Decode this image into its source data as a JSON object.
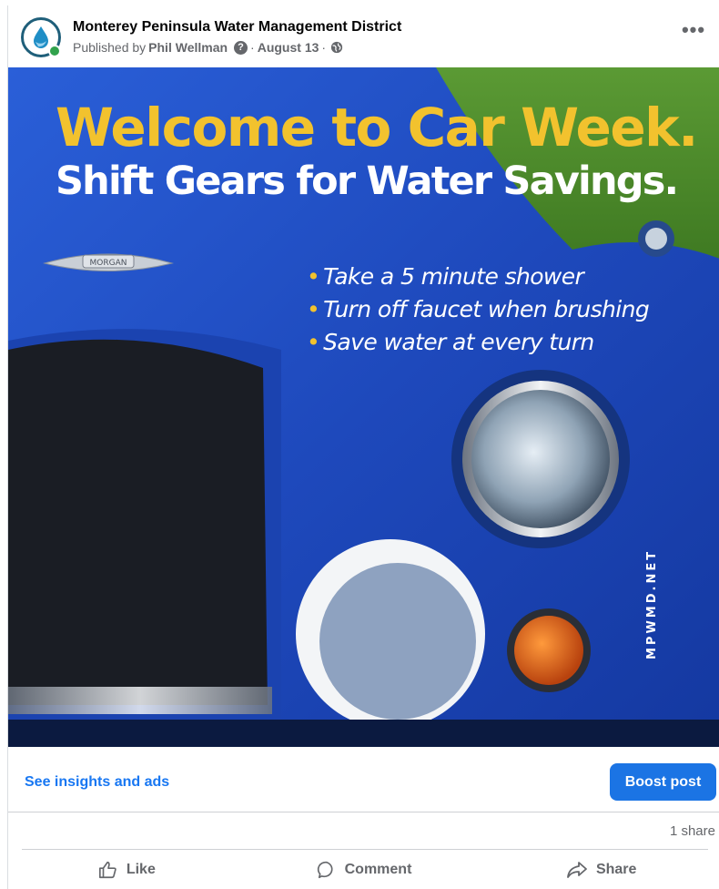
{
  "post": {
    "page_name": "Monterey Peninsula Water Management District",
    "published_by_prefix": "Published by",
    "author": "Phil Wellman",
    "separator": "·",
    "date": "August 13",
    "privacy_icon": "globe-icon",
    "help_icon": "question-icon",
    "more_label": "•••"
  },
  "image": {
    "headline": "Welcome to Car Week.",
    "subhead": "Shift Gears for Water Savings.",
    "bullets": [
      "Take a 5 minute shower",
      "Turn off faucet when brushing",
      "Save water at every turn"
    ],
    "bullet_marker": "•",
    "watermark": "MPWMD.NET",
    "badge": "MORGAN",
    "colors": {
      "headline": "#f2c22e",
      "car_body": "#1f4fc4",
      "grass": "#4e8a2a"
    }
  },
  "insights": {
    "link_label": "See insights and ads",
    "boost_label": "Boost post"
  },
  "stats": {
    "shares": "1 share"
  },
  "actions": {
    "like": "Like",
    "comment": "Comment",
    "share": "Share"
  },
  "colors": {
    "accent": "#1877f2",
    "button": "#1b74e4",
    "secondary_text": "#65676b"
  }
}
